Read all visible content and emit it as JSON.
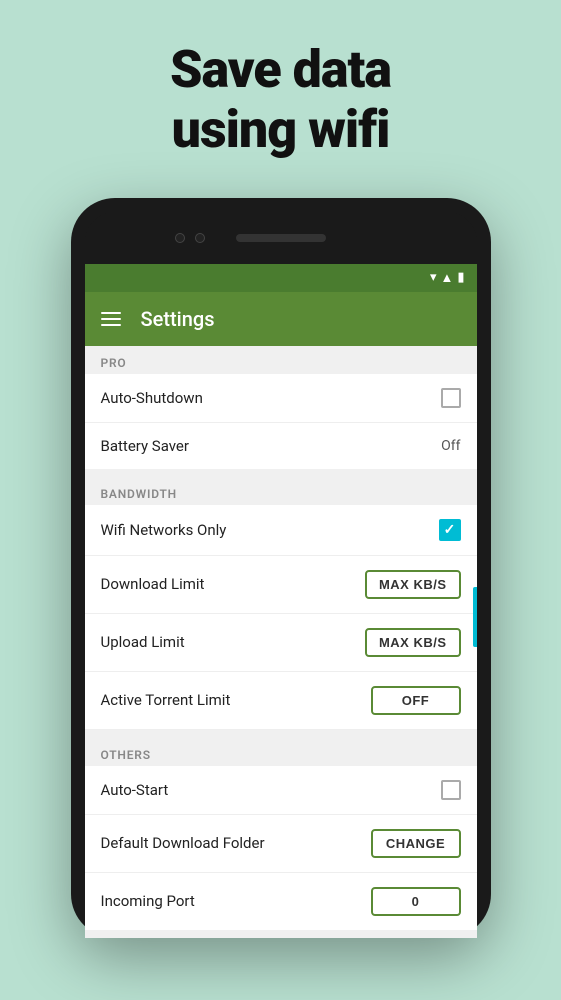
{
  "hero": {
    "line1": "Save data",
    "line2": "using wifi"
  },
  "appbar": {
    "title": "Settings"
  },
  "sections": [
    {
      "id": "pro",
      "header": "PRO",
      "rows": [
        {
          "id": "auto-shutdown",
          "label": "Auto-Shutdown",
          "control": "checkbox-unchecked"
        },
        {
          "id": "battery-saver",
          "label": "Battery Saver",
          "control": "text",
          "value": "Off"
        }
      ]
    },
    {
      "id": "bandwidth",
      "header": "BANDWIDTH",
      "rows": [
        {
          "id": "wifi-networks-only",
          "label": "Wifi Networks Only",
          "control": "checkbox-checked"
        },
        {
          "id": "download-limit",
          "label": "Download Limit",
          "control": "button",
          "value": "MAX KB/S"
        },
        {
          "id": "upload-limit",
          "label": "Upload Limit",
          "control": "button",
          "value": "MAX KB/S"
        },
        {
          "id": "active-torrent-limit",
          "label": "Active Torrent Limit",
          "control": "button",
          "value": "OFF"
        }
      ]
    },
    {
      "id": "others",
      "header": "OTHERS",
      "rows": [
        {
          "id": "auto-start",
          "label": "Auto-Start",
          "control": "checkbox-unchecked"
        },
        {
          "id": "default-download-folder",
          "label": "Default Download Folder",
          "control": "button",
          "value": "CHANGE"
        },
        {
          "id": "incoming-port",
          "label": "Incoming Port",
          "control": "button",
          "value": "0"
        }
      ]
    }
  ]
}
